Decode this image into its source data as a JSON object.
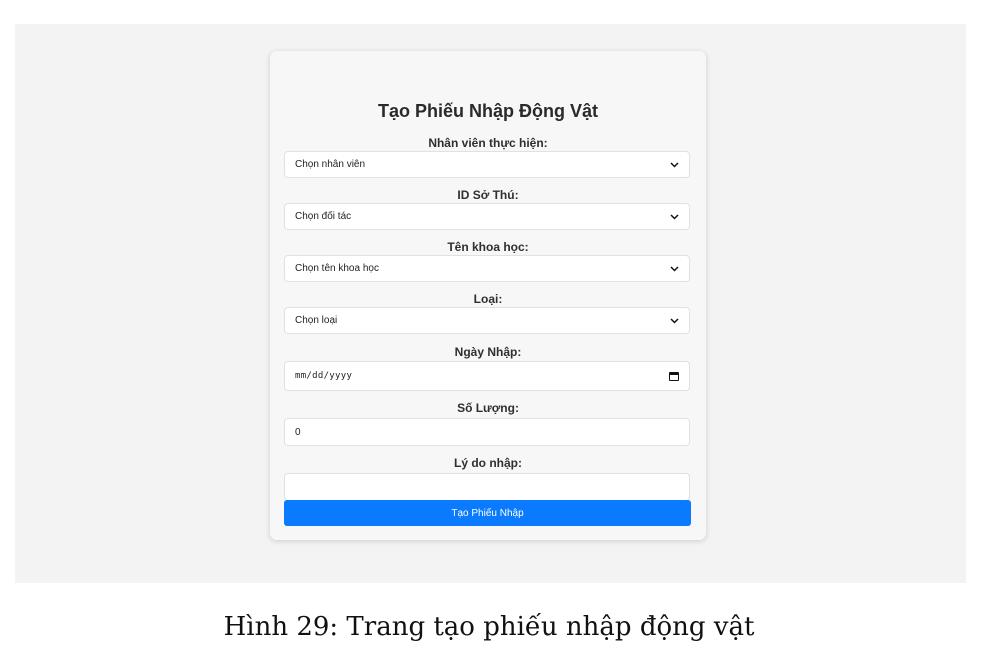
{
  "form": {
    "title": "Tạo Phiếu Nhập Động Vật",
    "fields": [
      {
        "label": "Nhân viên thực hiện:",
        "value": "Chọn nhân viên",
        "type": "select"
      },
      {
        "label": "ID Sở Thú:",
        "value": "Chọn đối tác",
        "type": "select"
      },
      {
        "label": "Tên khoa học:",
        "value": "Chọn tên khoa học",
        "type": "select"
      },
      {
        "label": "Loại:",
        "value": "Chọn loại",
        "type": "select"
      },
      {
        "label": "Ngày Nhập:",
        "value": "mm/dd/yyyy",
        "type": "date"
      },
      {
        "label": "Số Lượng:",
        "value": "0",
        "type": "number"
      },
      {
        "label": "Lý do nhập:",
        "value": "",
        "type": "text"
      }
    ],
    "submit_label": "Tạo Phiếu Nhập"
  },
  "caption": "Hình 29: Trang tạo phiếu nhập động vật",
  "colors": {
    "accent": "#0a7bff",
    "background": "#f3f3f3",
    "card": "#f7f7f7"
  },
  "icons": {
    "select": "chevron-down-icon",
    "date": "calendar-icon"
  }
}
